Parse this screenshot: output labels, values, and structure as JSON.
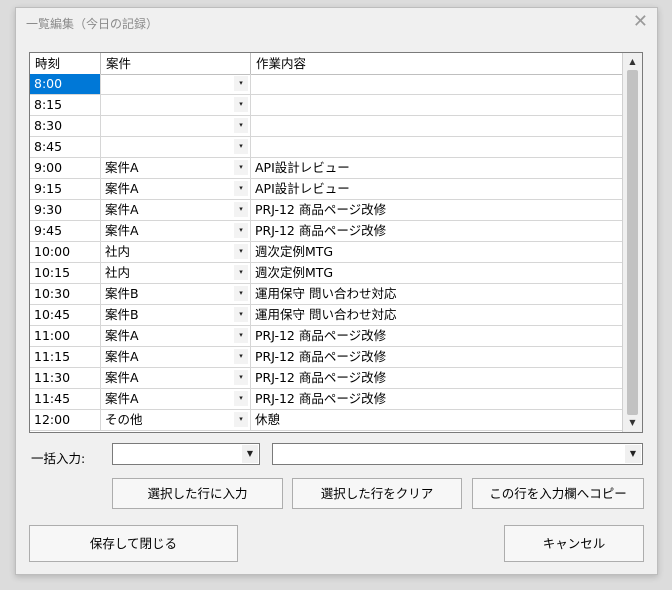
{
  "window": {
    "title": "一覧編集（今日の記録）",
    "close_glyph": "✕"
  },
  "grid": {
    "headers": {
      "time": "時刻",
      "case": "案件",
      "work": "作業内容"
    },
    "rows": [
      {
        "time": "8:00",
        "case": "",
        "work": ""
      },
      {
        "time": "8:15",
        "case": "",
        "work": ""
      },
      {
        "time": "8:30",
        "case": "",
        "work": ""
      },
      {
        "time": "8:45",
        "case": "",
        "work": ""
      },
      {
        "time": "9:00",
        "case": "案件A",
        "work": "API設計レビュー"
      },
      {
        "time": "9:15",
        "case": "案件A",
        "work": "API設計レビュー"
      },
      {
        "time": "9:30",
        "case": "案件A",
        "work": "PRJ-12 商品ページ改修"
      },
      {
        "time": "9:45",
        "case": "案件A",
        "work": "PRJ-12 商品ページ改修"
      },
      {
        "time": "10:00",
        "case": "社内",
        "work": "週次定例MTG"
      },
      {
        "time": "10:15",
        "case": "社内",
        "work": "週次定例MTG"
      },
      {
        "time": "10:30",
        "case": "案件B",
        "work": "運用保守 問い合わせ対応"
      },
      {
        "time": "10:45",
        "case": "案件B",
        "work": "運用保守 問い合わせ対応"
      },
      {
        "time": "11:00",
        "case": "案件A",
        "work": "PRJ-12 商品ページ改修"
      },
      {
        "time": "11:15",
        "case": "案件A",
        "work": "PRJ-12 商品ページ改修"
      },
      {
        "time": "11:30",
        "case": "案件A",
        "work": "PRJ-12 商品ページ改修"
      },
      {
        "time": "11:45",
        "case": "案件A",
        "work": "PRJ-12 商品ページ改修"
      },
      {
        "time": "12:00",
        "case": "その他",
        "work": "休憩"
      }
    ],
    "selected_row": 0,
    "dropdown_glyph": "▾"
  },
  "bulk_input": {
    "label": "一括入力:",
    "case_value": "",
    "work_value": ""
  },
  "buttons": {
    "apply_selected": "選択した行に入力",
    "clear_selected": "選択した行をクリア",
    "copy_to_input": "この行を入力欄へコピー",
    "save_close": "保存して閉じる",
    "cancel": "キャンセル"
  },
  "colors": {
    "selection": "#0078d7",
    "window_bg": "#f0f0f0"
  },
  "icons": {
    "scroll_up": "scroll-up-icon",
    "scroll_down": "scroll-down-icon",
    "close": "close-icon"
  }
}
